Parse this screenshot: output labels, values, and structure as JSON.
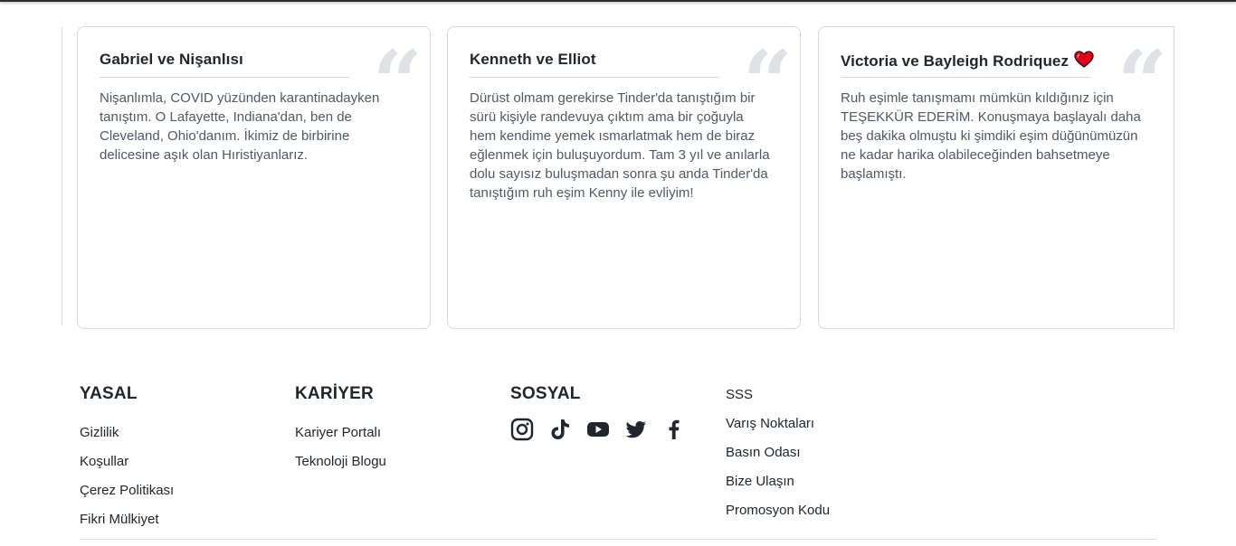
{
  "testimonials": [
    {
      "name": "Gabriel ve Nişanlısı",
      "quote_icon": "quote-icon",
      "text": "Nişanlımla, COVID yüzünden karantinadayken tanıştım. O Lafayette, Indiana'dan, ben de Cleveland, Ohio'danım. İkimiz de birbirine delicesine aşık olan Hıristiyanlarız."
    },
    {
      "name": "Kenneth ve Elliot",
      "quote_icon": "quote-icon",
      "text": "Dürüst olmam gerekirse Tinder'da tanıştığım bir sürü kişiyle randevuya çıktım ama bir çoğuyla hem kendime yemek ısmarlatmak hem de biraz eğlenmek için buluşuyordum. Tam 3 yıl ve anılarla dolu sayısız buluşmadan sonra şu anda Tinder'da tanıştığım ruh eşim Kenny ile evliyim!"
    },
    {
      "name": "Victoria ve Bayleigh Rodriquez",
      "name_icon": "heart-icon",
      "quote_icon": "quote-icon",
      "text": "Ruh eşimle tanışmamı mümkün kıldığınız için TEŞEKKÜR EDERİM. Konuşmaya başlayalı daha beş dakika olmuştu ki şimdiki eşim düğünümüzün ne kadar harika olabileceğinden bahsetmeye başlamıştı."
    }
  ],
  "footer": {
    "legal": {
      "heading": "YASAL",
      "links": [
        "Gizlilik",
        "Koşullar",
        "Çerez Politikası",
        "Fikri Mülkiyet"
      ]
    },
    "careers": {
      "heading": "KARİYER",
      "links": [
        "Kariyer Portalı",
        "Teknoloji Blogu"
      ]
    },
    "social": {
      "heading": "SOSYAL",
      "icons": [
        "instagram-icon",
        "tiktok-icon",
        "youtube-icon",
        "twitter-icon",
        "facebook-icon"
      ]
    },
    "misc_links": [
      "SSS",
      "Varış Noktaları",
      "Basın Odası",
      "Bize Ulaşın",
      "Promosyon Kodu"
    ]
  },
  "colors": {
    "text": "#21262e",
    "body_text": "#505965",
    "border": "#d6d9de",
    "quote_mark": "#dfe2e6",
    "heart": "#e0001b"
  }
}
